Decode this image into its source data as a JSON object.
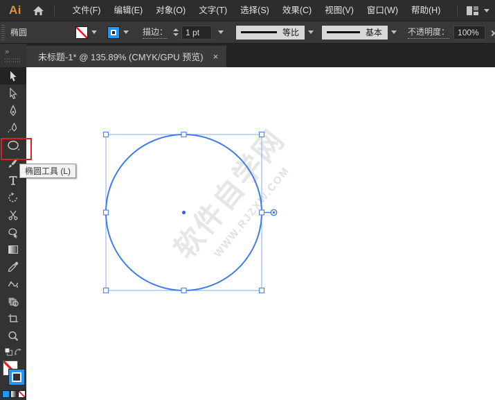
{
  "menu_bar": {
    "logo": "Ai",
    "items": [
      "文件(F)",
      "编辑(E)",
      "对象(O)",
      "文字(T)",
      "选择(S)",
      "效果(C)",
      "视图(V)",
      "窗口(W)",
      "帮助(H)"
    ]
  },
  "options_bar": {
    "tool_context_label": "椭圆",
    "stroke_label": "描边：",
    "stroke_weight": "1 pt",
    "variable_width_profile": "等比",
    "brush_definition": "基本",
    "opacity_label": "不透明度：",
    "opacity_value": "100%"
  },
  "document_tab": {
    "title": "未标题-1* @ 135.89% (CMYK/GPU 预览)",
    "close_glyph": "×",
    "zoom_percent": "135.89%",
    "color_mode": "CMYK/GPU 预览"
  },
  "toolbar": {
    "collapse_glyph": "▶▶",
    "tools": [
      "selection-tool",
      "direct-selection-tool",
      "pen-tool",
      "curvature-tool",
      "ellipse-tool",
      "paintbrush-tool",
      "type-tool",
      "rotate-tool",
      "scissors-tool",
      "shaper-tool",
      "gradient-tool",
      "eyedropper-tool",
      "blend-tool",
      "shape-builder-tool",
      "artboard-tool",
      "zoom-tool"
    ],
    "selected_tool": "selection-tool",
    "highlighted_tool": "ellipse-tool"
  },
  "tooltip": {
    "text": "椭圆工具 (L)"
  },
  "canvas": {
    "watermark_line1": "软件自学网",
    "watermark_line2": "WWW.RJZXW.COM"
  },
  "icons": [
    "home-icon",
    "workspace-switcher-icon",
    "chevron-down-icon",
    "fill-none-swatch",
    "stroke-color-swatch",
    "stepper-icon",
    "options-overflow-icon",
    "tab-close-icon",
    "default-fill-stroke-icon",
    "swap-fill-stroke-icon",
    "color-button",
    "gradient-button",
    "none-button"
  ],
  "colors": {
    "selection_blue": "#3b7cec",
    "bounding_box_blue": "#8aa8f0",
    "stroke_swatch_blue": "#2496f5",
    "highlight_red": "#e02020",
    "ai_logo_orange": "#e0913e",
    "ui_dark": "#2d2d2d",
    "canvas_white": "#ffffff",
    "watermark_gray": "#e6e6e6"
  }
}
